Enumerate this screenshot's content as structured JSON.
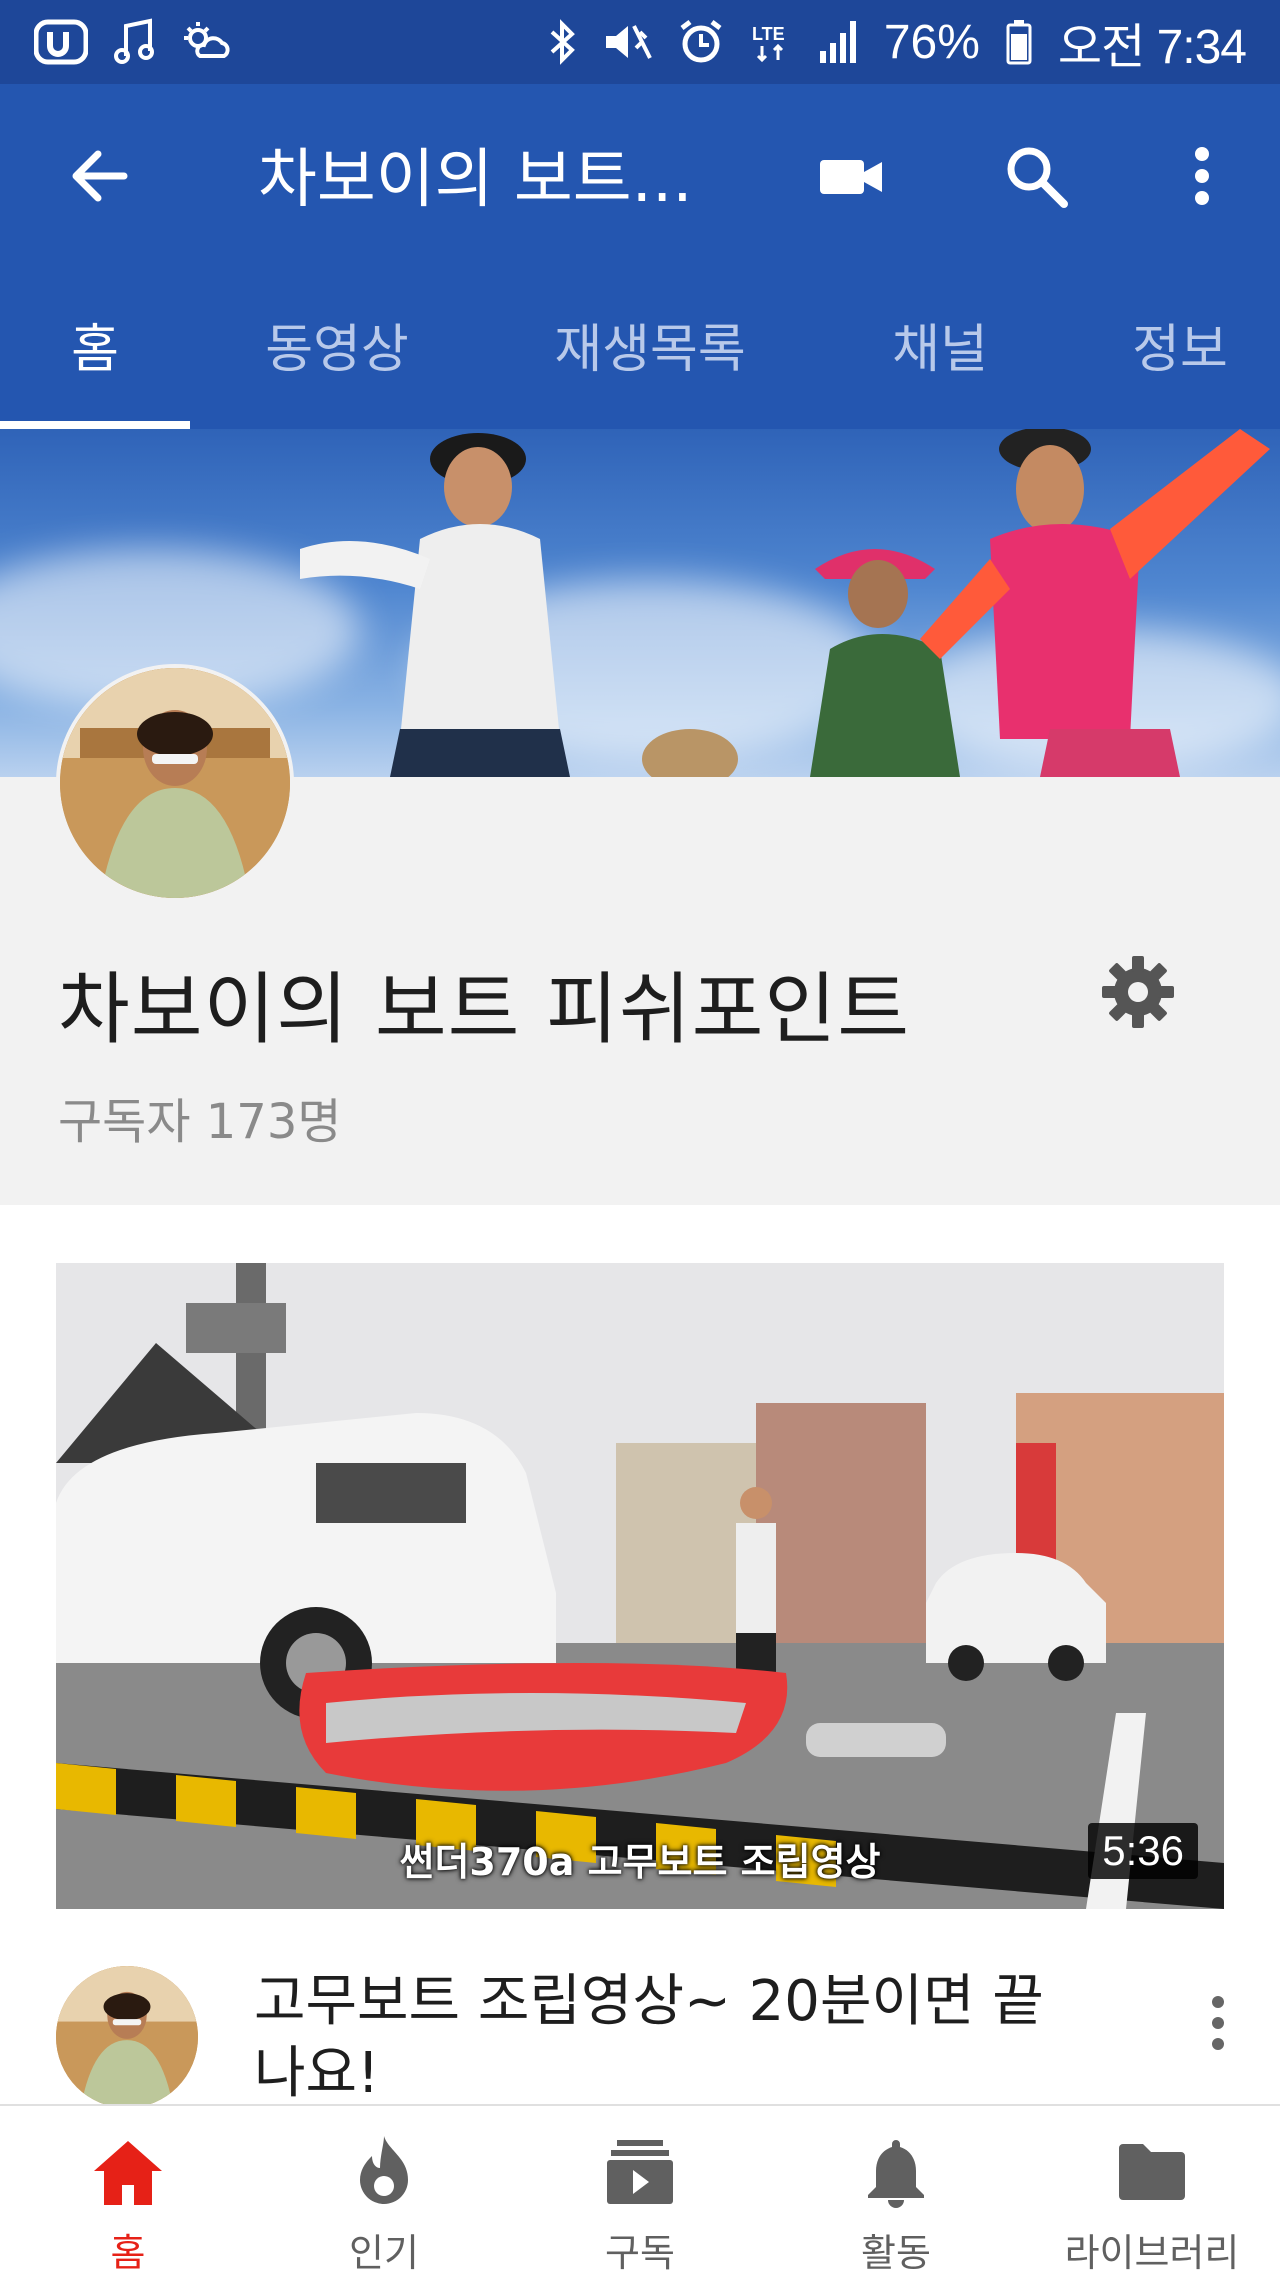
{
  "status_bar": {
    "battery_percent": "76%",
    "time": "오전 7:34",
    "icons": [
      "app-u-icon",
      "music-note-icon",
      "weather-icon",
      "bluetooth-icon",
      "mute-icon",
      "alarm-icon",
      "lte-icon",
      "signal-icon",
      "battery-icon"
    ]
  },
  "app_bar": {
    "title": "차보이의 보트...",
    "colors": {
      "bar": "#2456b0",
      "status": "#1e4799"
    }
  },
  "tabs": [
    {
      "label": "홈",
      "active": true
    },
    {
      "label": "동영상",
      "active": false
    },
    {
      "label": "재생목록",
      "active": false
    },
    {
      "label": "채널",
      "active": false
    },
    {
      "label": "정보",
      "active": false
    }
  ],
  "channel": {
    "name": "차보이의 보트 피쉬포인트",
    "subscribers": "구독자 173명"
  },
  "video": {
    "thumbnail_caption": "썬더370a 고무보트 조립영상",
    "duration": "5:36",
    "title": "고무보트 조립영상~ 20분이면 끝나요!"
  },
  "bottom_nav": {
    "accent": "#e62117",
    "items": [
      {
        "label": "홈",
        "icon": "home-icon",
        "active": true
      },
      {
        "label": "인기",
        "icon": "trending-flame-icon",
        "active": false
      },
      {
        "label": "구독",
        "icon": "subscriptions-icon",
        "active": false
      },
      {
        "label": "활동",
        "icon": "bell-icon",
        "active": false
      },
      {
        "label": "라이브러리",
        "icon": "folder-icon",
        "active": false
      }
    ]
  }
}
